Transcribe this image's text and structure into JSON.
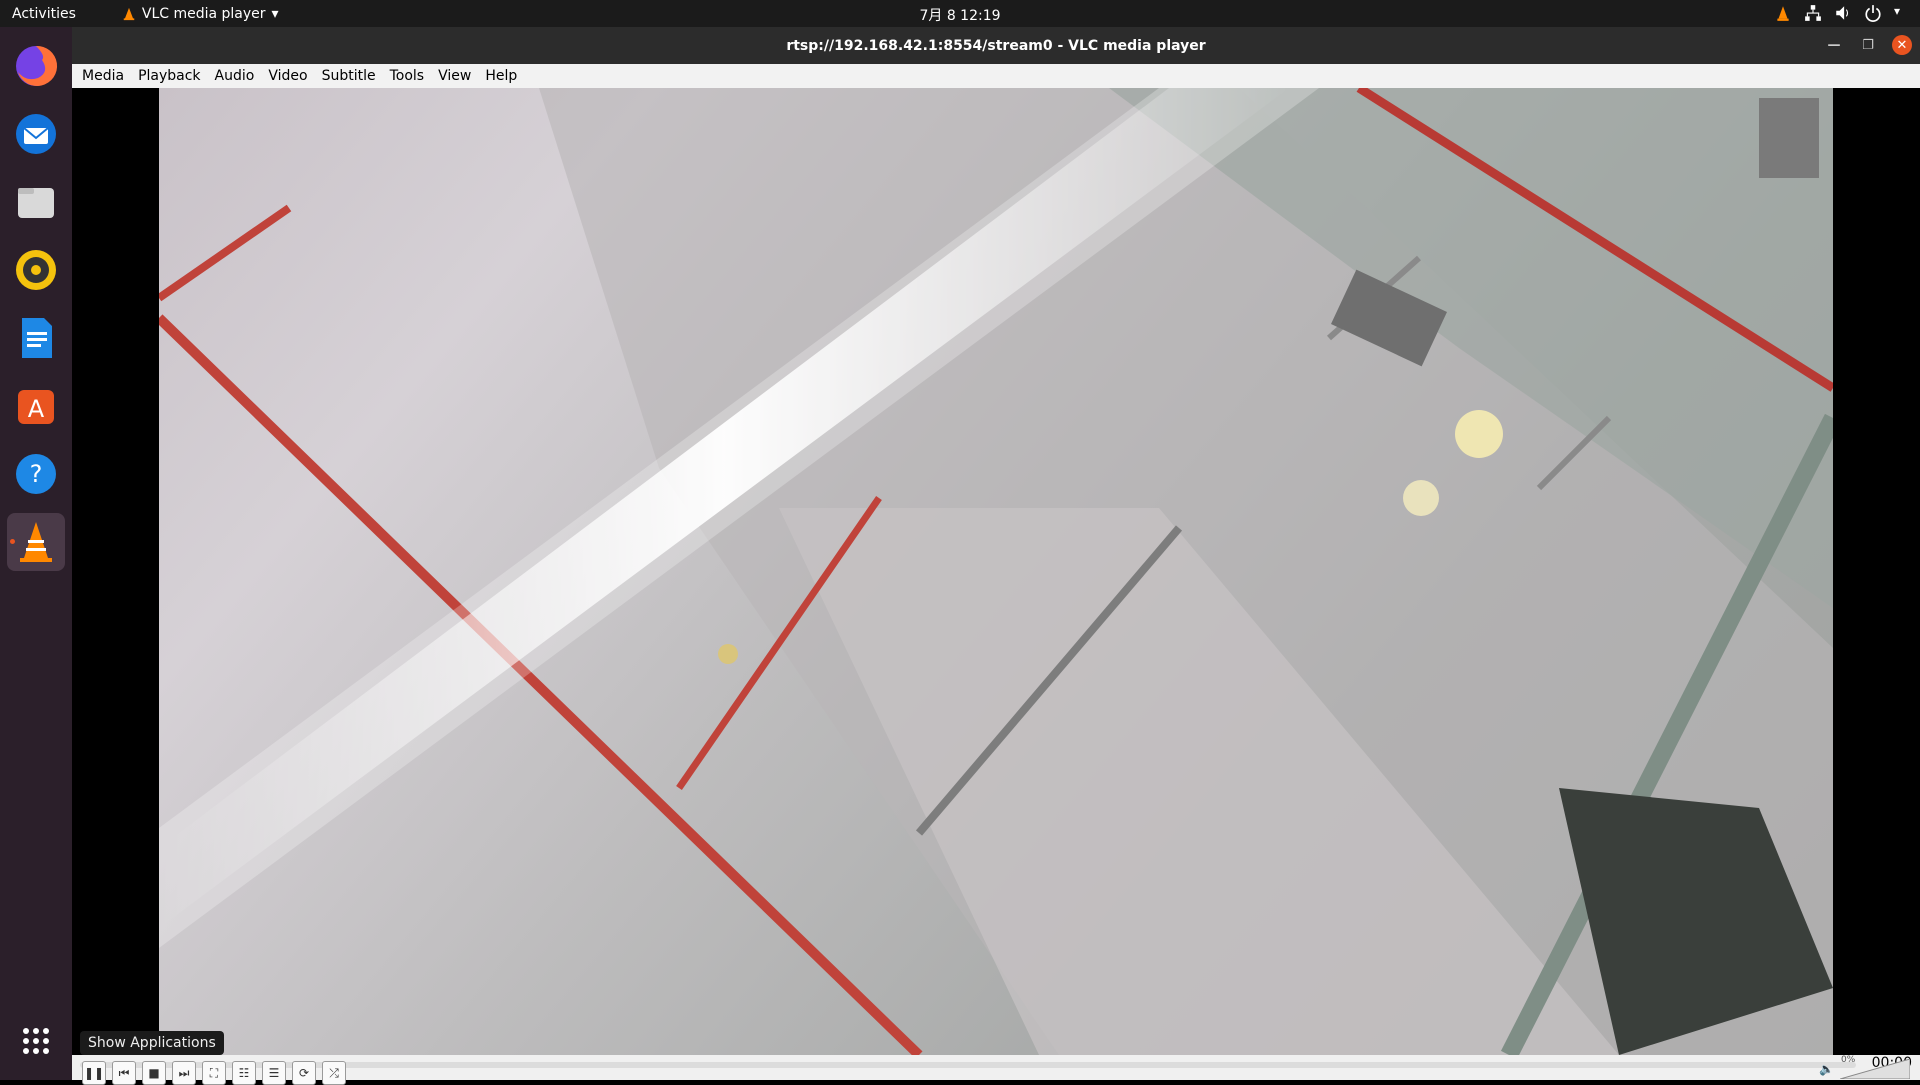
{
  "topbar": {
    "activities": "Activities",
    "app_menu": "VLC media player",
    "clock": "7月 8  12:19"
  },
  "dock": {
    "items": [
      {
        "name": "Firefox"
      },
      {
        "name": "Thunderbird"
      },
      {
        "name": "Files"
      },
      {
        "name": "Rhythmbox"
      },
      {
        "name": "LibreOffice Writer"
      },
      {
        "name": "Ubuntu Software"
      },
      {
        "name": "Help"
      },
      {
        "name": "VLC media player"
      }
    ],
    "tooltip": "Show Applications"
  },
  "window": {
    "title": "rtsp://192.168.42.1:8554/stream0 - VLC media player",
    "menu": [
      "Media",
      "Playback",
      "Audio",
      "Video",
      "Subtitle",
      "Tools",
      "View",
      "Help"
    ]
  },
  "controls": {
    "time": "00:00",
    "volume_label": "0%"
  },
  "colors": {
    "topbar": "#1b1b1b",
    "dock": "#2b1f2a",
    "accent": "#e95420"
  }
}
